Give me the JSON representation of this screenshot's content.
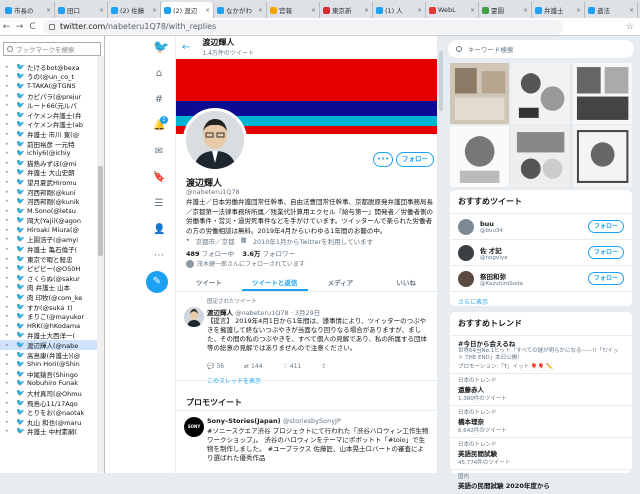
{
  "browser": {
    "tabs": [
      {
        "label": "市長の",
        "color": "#1da1f2"
      },
      {
        "label": "田口",
        "color": "#1da1f2"
      },
      {
        "label": "(2) 佐藤",
        "color": "#1da1f2"
      },
      {
        "label": "(2) 渡辺",
        "color": "#1da1f2"
      },
      {
        "label": "なかがわ",
        "color": "#1da1f2"
      },
      {
        "label": "官報",
        "color": "#f4a400"
      },
      {
        "label": "東京新",
        "color": "#d32f2f"
      },
      {
        "label": "(1) 人",
        "color": "#1da1f2"
      },
      {
        "label": "WebL",
        "color": "#e53935"
      },
      {
        "label": "霊園",
        "color": "#43a047"
      },
      {
        "label": "弁護士",
        "color": "#1da1f2"
      },
      {
        "label": "遺法",
        "color": "#1da1f2"
      }
    ],
    "url_host": "twitter.com",
    "url_path": "/nabeteru1Q78/with_replies",
    "back": "←",
    "forward": "→",
    "reload": "C",
    "star": "☆"
  },
  "bookmarks": {
    "search_placeholder": "ブックマークを検索",
    "items": [
      "たけるbot@bexa",
      "うの(@un_co_t",
      "T-TAKA(@TGNS",
      "カピパラ(@prejur",
      "ルート66(元ルパ",
      "イケメン弁護士(弁",
      "イケメン弁護士(ab",
      "弁護士 市川 寛(@",
      "前田裕彦 一元特",
      "ichiy6(@ichiy",
      "猫熱みずほ(@mi",
      "弁護士 大山史朗",
      "望月夏武Hiromu",
      "河西邦剛(@kuni",
      "河西邦剛(@kunik",
      "M.Sono(@Ietsu",
      "岡大(Yaji)(@agon",
      "Hiroaki Miura(@",
      "上園浩子(@amyi",
      "弁護士 亀石倫子(",
      "東京で暇と殺忠",
      "ピピピー(@O50H",
      "さくらぬ(@sakur",
      "肉 弁護士 山本",
      "肉 印牧(@com_ke",
      "すか(@suka_t)",
      "まりこ(@mayukor",
      "HRK(@hKodama",
      "弁護士大西洋一(",
      "渡辺輝人(@nabe",
      "高島康(弁護士)(@",
      "Shin Hori(@Shin",
      "中尾猿吾(Shingo",
      "Nobuhiro Funak",
      "大村真司(@Ohmu",
      "飛島心11/17Ago",
      "とりをお(@naotak",
      "丸山 和也(@maru",
      "弁護士 中村素嗣("
    ],
    "selected_index": 29
  },
  "nav": {
    "logo_icon": "twitter-bird-icon",
    "notif_count": "2"
  },
  "profile": {
    "header_name": "渡辺輝人",
    "header_count": "1.4万件のツイート",
    "name": "渡辺輝人",
    "handle": "@nabeteru1Q78",
    "bio": "弁護士／日本労働弁護団常任幹事、自由法曹団常任幹事、京都脱原発弁護団事務局長／京都第一法律事務所所属／残業代計算用エクセル『給与第一』開発者／労働者側の労働事件・営災・過労死事件などを手がけています。ツイッターんで楽られた労働者の方の労働相談は無料。2019年4月からいわゆる1年間のお籠の中。",
    "location": "京都市／京都",
    "joined": "2010年1月からTwitterを利用しています",
    "following_count": "489",
    "following_label": "フォロー中",
    "followers_count": "3.6万",
    "followers_label": "フォロワー",
    "followed_by_note": "茂木健一郎さんにフォローされています",
    "more_label": "•••",
    "follow_label": "フォロー"
  },
  "profile_tabs": [
    "ツイート",
    "ツイートと返信",
    "メディア",
    "いいね"
  ],
  "active_tab_index": 1,
  "pinned_tweet": {
    "pinned_label": "固定されたツイート",
    "name": "渡辺輝人",
    "handle": "@nabeteru1Q78 · 3月29日",
    "body": "【提言】 2019年4月1日から1年間は、謹事情により、ツイッターのつぶやきを擁護して終ないつぶやきが当面なり回りなる場合がありますが、ました、その間の私のつぶやきを、すべて個人の見解であり、私の所属する団体等の総意の見解ではありませんので注意ください。",
    "replies": "36",
    "retweets": "144",
    "likes": "411",
    "show_thread": "このスレッドを表示"
  },
  "promoted": {
    "section_title": "プロモツイート",
    "logo_text": "SONY",
    "name": "Sony–Stories(Japan)",
    "handle": "@storiesbySonyJP",
    "body": "#ソニースクエア渋谷 プロジェクトにて行われた「渋谷ハロウィン工作生物ワークショップ」。 渋谷のハロウィンをテーマにポボットト「#toio」で生物を制作しました。 #ユープラクス 佐藤匠、山本晃士ロバートの審査により選ばれた優秀作品"
  },
  "right": {
    "search_placeholder": "キーワード検索",
    "who_to_follow_title": "おすすめツイート",
    "suggestions": [
      {
        "name": "buu",
        "handle": "@buu34",
        "follow": "フォロー"
      },
      {
        "name": "佐 才記",
        "handle": "@noguiya",
        "follow": "フォロー"
      },
      {
        "name": "祭田和弥",
        "handle": "@KazuhiroSoda",
        "follow": "フォロー"
      }
    ],
    "show_more": "さらに表示",
    "trends_title": "おすすめトレンド",
    "trends": [
      {
        "tag": "#今日から会えるね",
        "desc": "世界64当No.1ヒット「すべての謎が明らかになる——!!「T/イット THE END」本日公開!",
        "count": "",
        "promoted": "プロモーション:「T」イット 🎈🎈 ✏️"
      },
      {
        "context": "日本のトレンド",
        "tag": "遠藤赤人",
        "count": "1,380件のツイート"
      },
      {
        "context": "日本のトレンド",
        "tag": "橋本理奈",
        "count": "6,642件のツイート"
      },
      {
        "context": "日本のトレンド",
        "tag": "英語民間試験",
        "count": "45,774件のツイート"
      },
      {
        "context": "国内",
        "tag": "英語の民間試験 2020年度から",
        "count": ""
      }
    ]
  }
}
